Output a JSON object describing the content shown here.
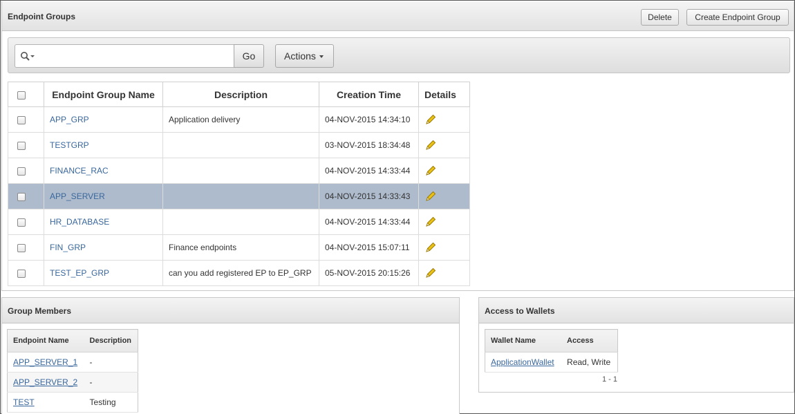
{
  "endpoint_groups": {
    "title": "Endpoint Groups",
    "delete_label": "Delete",
    "create_label": "Create Endpoint Group",
    "search": {
      "value": "",
      "placeholder": ""
    },
    "go_label": "Go",
    "actions_label": "Actions",
    "columns": {
      "name": "Endpoint Group Name",
      "description": "Description",
      "creation_time": "Creation Time",
      "details": "Details"
    },
    "rows": [
      {
        "name": "APP_GRP",
        "description": "Application delivery",
        "creation_time": "04-NOV-2015 14:34:10"
      },
      {
        "name": "TESTGRP",
        "description": "",
        "creation_time": "03-NOV-2015 18:34:48"
      },
      {
        "name": "FINANCE_RAC",
        "description": "",
        "creation_time": "04-NOV-2015 14:33:44"
      },
      {
        "name": "APP_SERVER",
        "description": "",
        "creation_time": "04-NOV-2015 14:33:43"
      },
      {
        "name": "HR_DATABASE",
        "description": "",
        "creation_time": "04-NOV-2015 14:33:44"
      },
      {
        "name": "FIN_GRP",
        "description": "Finance endpoints",
        "creation_time": "04-NOV-2015 15:07:11"
      },
      {
        "name": "TEST_EP_GRP",
        "description": "can you add registered EP to EP_GRP",
        "creation_time": "05-NOV-2015 20:15:26"
      }
    ],
    "selected_row": "APP_SERVER"
  },
  "group_members": {
    "title": "Group Members",
    "columns": {
      "endpoint_name": "Endpoint Name",
      "description": "Description"
    },
    "rows": [
      {
        "endpoint_name": "APP_SERVER_1",
        "description": "-"
      },
      {
        "endpoint_name": "APP_SERVER_2",
        "description": "-"
      },
      {
        "endpoint_name": "TEST",
        "description": "Testing"
      }
    ]
  },
  "access_to_wallets": {
    "title": "Access to Wallets",
    "columns": {
      "wallet_name": "Wallet Name",
      "access": "Access"
    },
    "rows": [
      {
        "wallet_name": "ApplicationWallet",
        "access": "Read, Write"
      }
    ],
    "pagination": "1 - 1"
  },
  "icons": {
    "search": "search-icon",
    "edit": "pencil-icon",
    "actions_caret": "chevron-down-icon"
  },
  "colors": {
    "link": "#39679c",
    "selected_row": "#aebbcc",
    "pencil": "#e8c21a"
  }
}
